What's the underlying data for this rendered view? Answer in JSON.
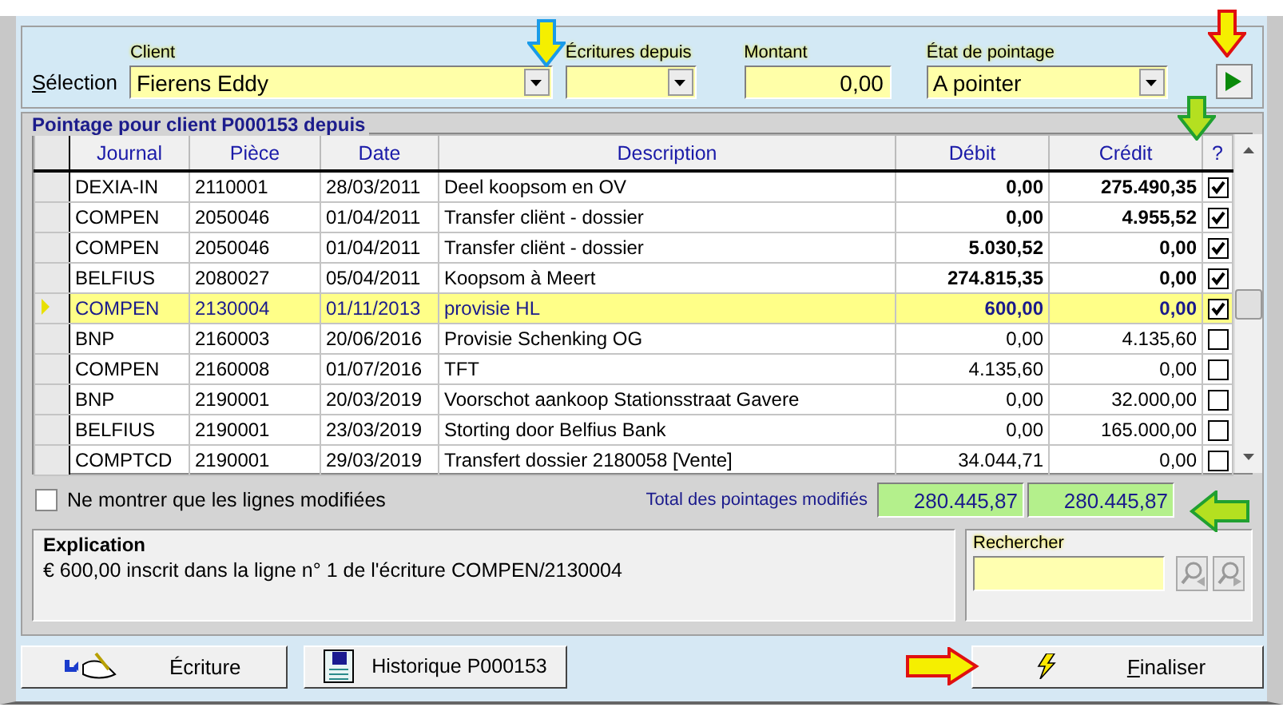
{
  "selection": {
    "label": "Sélection",
    "client": {
      "label": "Client",
      "value": "Fierens Eddy"
    },
    "since": {
      "label": "Écritures depuis"
    },
    "amount": {
      "label": "Montant",
      "value": "0,00"
    },
    "state": {
      "label": "État de pointage",
      "value": "A pointer"
    }
  },
  "grid": {
    "title": "Pointage pour client P000153 depuis",
    "columns": [
      "Journal",
      "Pièce",
      "Date",
      "Description",
      "Débit",
      "Crédit",
      "?"
    ],
    "rows": [
      {
        "journal": "DEXIA-IN",
        "piece": "2110001",
        "date": "28/03/2011",
        "description": "Deel koopsom en OV",
        "debit": "0,00",
        "credit": "275.490,35",
        "checked": true,
        "selected": false
      },
      {
        "journal": "COMPEN",
        "piece": "2050046",
        "date": "01/04/2011",
        "description": "Transfer cliënt - dossier",
        "debit": "0,00",
        "credit": "4.955,52",
        "checked": true,
        "selected": false
      },
      {
        "journal": "COMPEN",
        "piece": "2050046",
        "date": "01/04/2011",
        "description": "Transfer cliënt - dossier",
        "debit": "5.030,52",
        "credit": "0,00",
        "checked": true,
        "selected": false
      },
      {
        "journal": "BELFIUS",
        "piece": "2080027",
        "date": "05/04/2011",
        "description": "Koopsom à Meert",
        "debit": "274.815,35",
        "credit": "0,00",
        "checked": true,
        "selected": false
      },
      {
        "journal": "COMPEN",
        "piece": "2130004",
        "date": "01/11/2013",
        "description": "provisie HL",
        "debit": "600,00",
        "credit": "0,00",
        "checked": true,
        "selected": true
      },
      {
        "journal": "BNP",
        "piece": "2160003",
        "date": "20/06/2016",
        "description": "Provisie Schenking OG",
        "debit": "0,00",
        "credit": "4.135,60",
        "checked": false,
        "selected": false
      },
      {
        "journal": "COMPEN",
        "piece": "2160008",
        "date": "01/07/2016",
        "description": "TFT",
        "debit": "4.135,60",
        "credit": "0,00",
        "checked": false,
        "selected": false
      },
      {
        "journal": "BNP",
        "piece": "2190001",
        "date": "20/03/2019",
        "description": "Voorschot aankoop Stationsstraat Gavere",
        "debit": "0,00",
        "credit": "32.000,00",
        "checked": false,
        "selected": false
      },
      {
        "journal": "BELFIUS",
        "piece": "2190001",
        "date": "23/03/2019",
        "description": "Storting door Belfius Bank",
        "debit": "0,00",
        "credit": "165.000,00",
        "checked": false,
        "selected": false
      },
      {
        "journal": "COMPTCD",
        "piece": "2190001",
        "date": "29/03/2019",
        "description": "Transfert dossier 2180058 [Vente]",
        "debit": "34.044,71",
        "credit": "0,00",
        "checked": false,
        "selected": false
      }
    ]
  },
  "filter": {
    "label": "Ne montrer que les lignes modifiées",
    "checked": false
  },
  "totals": {
    "label": "Total des pointages modifiés",
    "debit": "280.445,87",
    "credit": "280.445,87"
  },
  "explanation": {
    "title": "Explication",
    "text": "€ 600,00 inscrit dans la ligne n° 1 de l'écriture COMPEN/2130004"
  },
  "search": {
    "label": "Rechercher"
  },
  "buttons": [
    {
      "label": "Écriture",
      "kind": "entry"
    },
    {
      "label": "Historique P000153",
      "kind": "history"
    },
    {
      "label": "Finaliser",
      "kind": "finalize"
    }
  ]
}
